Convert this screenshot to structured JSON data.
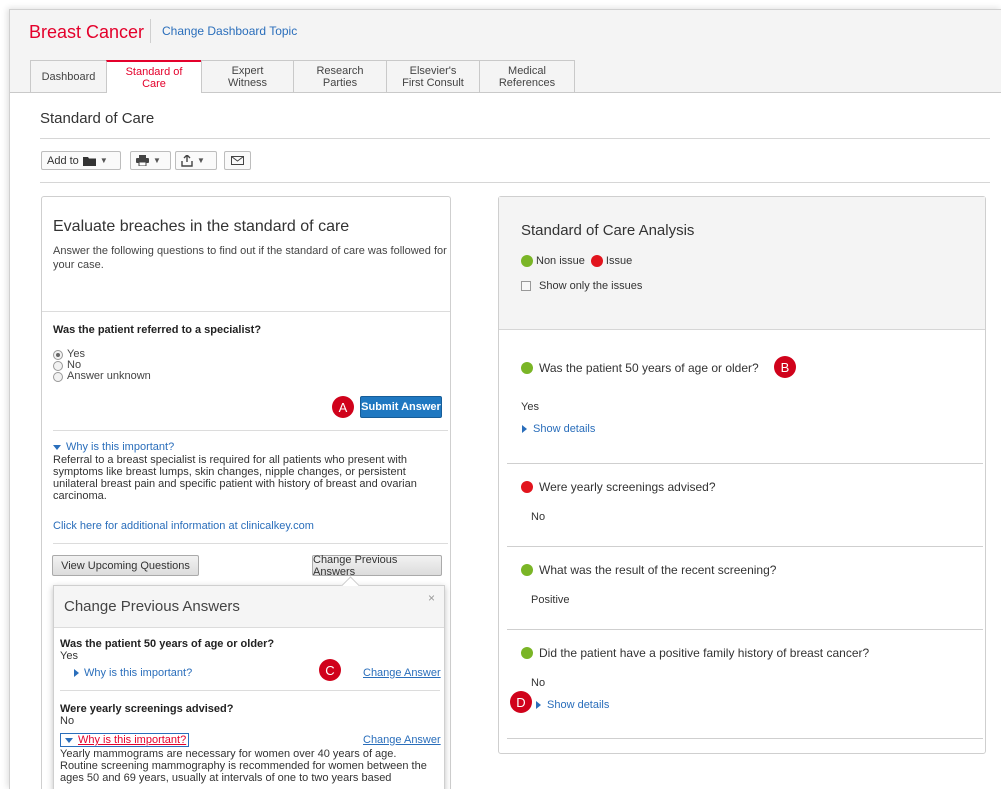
{
  "header": {
    "title": "Breast Cancer",
    "change_topic": "Change Dashboard Topic"
  },
  "tabs": [
    {
      "label": "Dashboard"
    },
    {
      "label": "Standard of\nCare"
    },
    {
      "label": "Expert\nWitness"
    },
    {
      "label": "Research\nParties"
    },
    {
      "label": "Elsevier's\nFirst Consult"
    },
    {
      "label": "Medical\nReferences"
    }
  ],
  "page": {
    "title": "Standard of Care"
  },
  "toolbar": {
    "add_to": "Add to"
  },
  "evaluate": {
    "title": "Evaluate breaches in the standard of care",
    "description": "Answer the following questions to find out if the standard of care was followed for your case.",
    "question": "Was the patient referred to a specialist?",
    "options": [
      "Yes",
      "No",
      "Answer unknown"
    ],
    "selected": "Yes",
    "submit_label": "Submit Answer",
    "why_label": "Why is this important?",
    "why_text": "Referral to a breast specialist is required for all patients who present with symptoms like breast lumps, skin changes, nipple changes, or persistent unilateral breast pain and specific patient with history of breast and ovarian carcinoma.",
    "info_link": "Click here for additional information at clinicalkey.com",
    "view_upcoming": "View Upcoming Questions",
    "change_previous": "Change Previous Answers"
  },
  "popover": {
    "title": "Change Previous Answers",
    "close": "×",
    "items": [
      {
        "question": "Was the patient 50 years of age or older?",
        "answer": "Yes",
        "why": "Why is this important?",
        "change": "Change Answer"
      },
      {
        "question": "Were yearly screenings advised?",
        "answer": "No",
        "why": "Why is this important?",
        "change": "Change Answer",
        "why_text": "Yearly mammograms are necessary for women over 40 years of age. Routine screening mammography is recommended for women between the ages 50 and 69 years, usually at intervals of one to two years based"
      }
    ]
  },
  "analysis": {
    "title": "Standard of Care Analysis",
    "legend_non_issue": "Non issue",
    "legend_issue": "Issue",
    "show_only_issues": "Show only the issues",
    "show_details": "Show details",
    "items": [
      {
        "question": "Was the patient 50 years of age or older?",
        "answer": "Yes",
        "status": "non-issue"
      },
      {
        "question": "Were yearly screenings advised?",
        "answer": "No",
        "status": "issue"
      },
      {
        "question": "What was the result of the recent screening?",
        "answer": "Positive",
        "status": "non-issue"
      },
      {
        "question": "Did the patient have a positive family history of breast cancer?",
        "answer": "No",
        "status": "non-issue"
      }
    ]
  },
  "markers": {
    "a": "A",
    "b": "B",
    "c": "C",
    "d": "D"
  },
  "colors": {
    "brand": "#e4002b",
    "link": "#2a6ebb",
    "submit": "#1f78c1",
    "non_issue": "#7ab526",
    "issue": "#e2141d",
    "marker": "#d0021b"
  }
}
